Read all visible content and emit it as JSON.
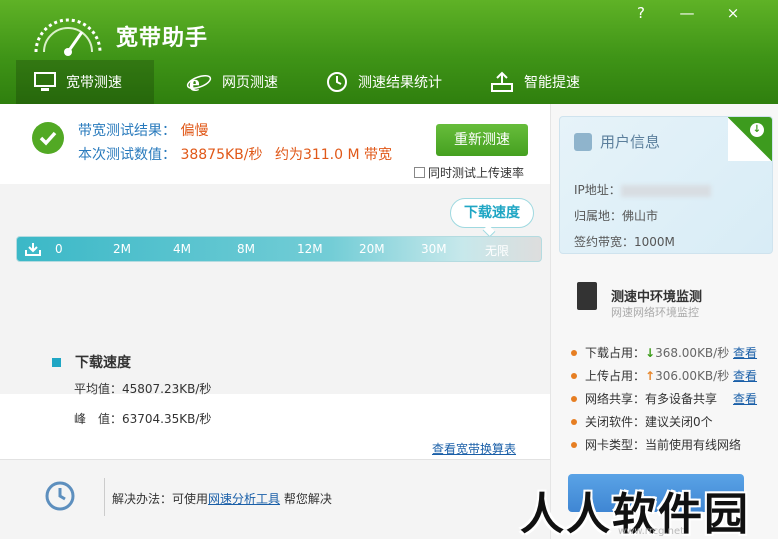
{
  "app": {
    "title": "宽带助手",
    "help_glyph": "?",
    "minimize_glyph": "—",
    "close_glyph": "×"
  },
  "nav": {
    "tabs": [
      {
        "label": "宽带测速",
        "icon": "monitor-icon",
        "active": true
      },
      {
        "label": "网页测速",
        "icon": "ie-browser-icon",
        "active": false
      },
      {
        "label": "测速结果统计",
        "icon": "clock-icon",
        "active": false
      },
      {
        "label": "智能提速",
        "icon": "router-icon",
        "active": false
      }
    ]
  },
  "result": {
    "label1": "带宽测试结果：",
    "value1": "偏慢",
    "label2": "本次测试数值：",
    "value2": "38875KB/秒",
    "value2_suffix": "约为311.0 M 带宽",
    "retest_label": "重新测速",
    "upload_checkbox_label": "同时测试上传速率",
    "upload_checked": false
  },
  "gauge": {
    "bubble_label": "下载速度",
    "ticks": [
      "0",
      "2M",
      "4M",
      "8M",
      "12M",
      "20M",
      "30M",
      "无限"
    ]
  },
  "stats": {
    "title": "下载速度",
    "avg": "平均值：45807.23KB/秒",
    "peak": "峰　值：63704.35KB/秒",
    "link": "查看宽带换算表"
  },
  "footer": {
    "prefix": "解决办法：可使用",
    "link": "网速分析工具",
    "suffix": " 帮您解决"
  },
  "user_info": {
    "title": "用户信息",
    "ip_label": "IP地址：",
    "location": "归属地：佛山市",
    "bandwidth": "签约带宽：1000M"
  },
  "monitor": {
    "title": "测速中环境监测",
    "subtitle": "网速网络环境监控",
    "items": [
      {
        "text": "下载占用：",
        "arrow": "↓",
        "value": "368.00KB/秒",
        "link": "查看"
      },
      {
        "text": "上传占用：",
        "arrow": "↑",
        "value": "306.00KB/秒",
        "link": "查看"
      },
      {
        "text": "网络共享：有多设备共享",
        "arrow": "",
        "value": "",
        "link": "查看"
      },
      {
        "text": "关闭软件：建议关闭0个",
        "arrow": "",
        "value": "",
        "link": ""
      },
      {
        "text": "网卡类型：当前使用有线网络",
        "arrow": "",
        "value": "",
        "link": ""
      }
    ]
  },
  "watermark": {
    "text": "人人软件园",
    "small": "www.rrcg.net"
  },
  "colors": {
    "header_green": "#3f9417",
    "accent_teal": "#1fa6c4",
    "value_orange": "#e05818",
    "label_blue": "#2a7bbd"
  }
}
